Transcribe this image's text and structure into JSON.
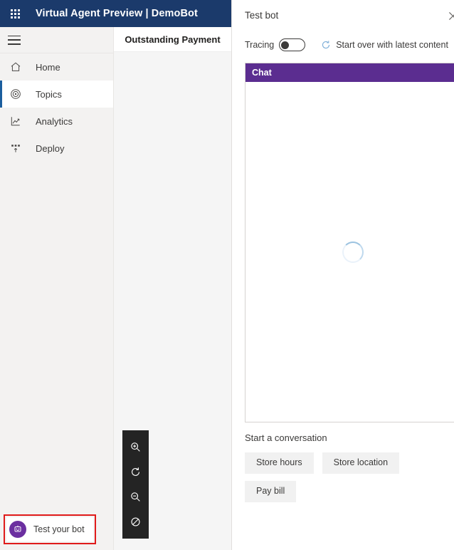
{
  "titlebar": {
    "waffle_icon": "waffle-grid-icon",
    "title": "Virtual Agent Preview | DemoBot",
    "background": "#1b3a6b"
  },
  "sidebar": {
    "hamburger_icon": "hamburger-icon",
    "items": [
      {
        "label": "Home",
        "icon": "home-icon",
        "selected": false
      },
      {
        "label": "Topics",
        "icon": "topics-broadcast-icon",
        "selected": true
      },
      {
        "label": "Analytics",
        "icon": "analytics-chart-icon",
        "selected": false
      },
      {
        "label": "Deploy",
        "icon": "deploy-upload-icon",
        "selected": false
      }
    ],
    "selected_accent": "#1b5e9e",
    "test_bot": {
      "label": "Test your bot",
      "avatar_icon": "bot-avatar-icon",
      "avatar_color": "#6b2fa0",
      "highlight_color": "#e01b1b"
    }
  },
  "canvas": {
    "tab_label": "Outstanding Payment",
    "background": "#f5f5f5",
    "zoom_controls": {
      "background": "#242424",
      "buttons": [
        {
          "icon": "zoom-in-icon",
          "name": "zoom-in-button"
        },
        {
          "icon": "reset-view-icon",
          "name": "reset-view-button"
        },
        {
          "icon": "zoom-out-icon",
          "name": "zoom-out-button"
        },
        {
          "icon": "fit-to-screen-icon",
          "name": "fit-to-screen-button"
        }
      ]
    }
  },
  "test_panel": {
    "title": "Test bot",
    "close_icon": "close-icon",
    "tracing_label": "Tracing",
    "tracing_on": false,
    "start_over_label": "Start over with latest content",
    "start_over_icon": "refresh-icon",
    "more_icon": "more-vertical-icon",
    "chat": {
      "header_label": "Chat",
      "header_color": "#5b2d90",
      "loading": true,
      "spinner_icon": "loading-spinner-icon"
    },
    "starters": {
      "title": "Start a conversation",
      "buttons": [
        "Store hours",
        "Store location",
        "Pay bill"
      ]
    }
  }
}
